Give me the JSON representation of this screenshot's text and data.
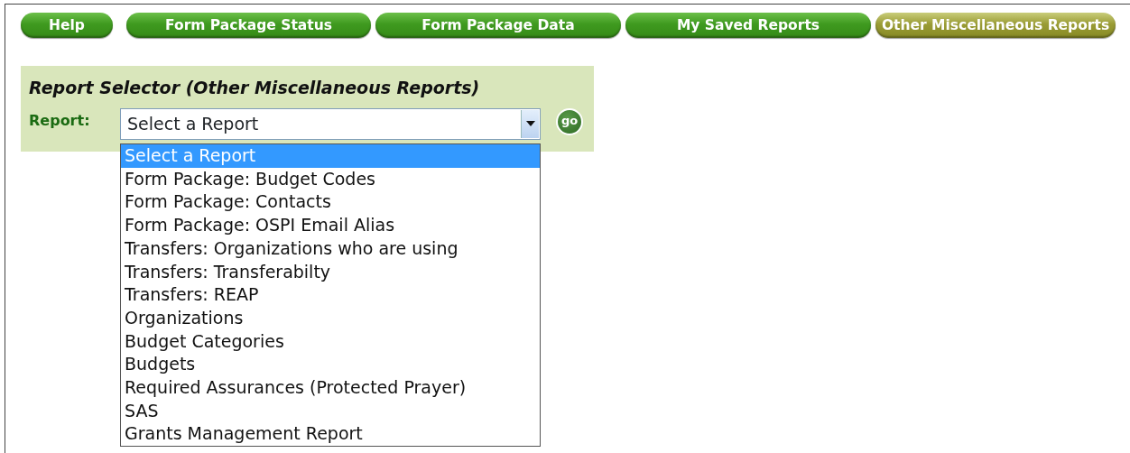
{
  "tabs": [
    {
      "label": "Help",
      "selected": false
    },
    {
      "label": "Form Package Status",
      "selected": false
    },
    {
      "label": "Form Package Data",
      "selected": false
    },
    {
      "label": "My Saved Reports",
      "selected": false
    },
    {
      "label": "Other Miscellaneous Reports",
      "selected": true
    }
  ],
  "report_selector": {
    "title": "Report Selector (Other Miscellaneous Reports)",
    "label": "Report:",
    "value": "Select a Report",
    "go_button": "go",
    "options": [
      {
        "label": "Select a Report",
        "selected": true
      },
      {
        "label": "Form Package: Budget Codes",
        "selected": false
      },
      {
        "label": "Form Package: Contacts",
        "selected": false
      },
      {
        "label": "Form Package: OSPI Email Alias",
        "selected": false
      },
      {
        "label": "Transfers: Organizations who are using",
        "selected": false
      },
      {
        "label": "Transfers: Transferabilty",
        "selected": false
      },
      {
        "label": "Transfers: REAP",
        "selected": false
      },
      {
        "label": "Organizations",
        "selected": false
      },
      {
        "label": "Budget Categories",
        "selected": false
      },
      {
        "label": "Budgets",
        "selected": false
      },
      {
        "label": "Required Assurances (Protected Prayer)",
        "selected": false
      },
      {
        "label": "SAS",
        "selected": false
      },
      {
        "label": "Grants Management Report",
        "selected": false
      }
    ]
  }
}
